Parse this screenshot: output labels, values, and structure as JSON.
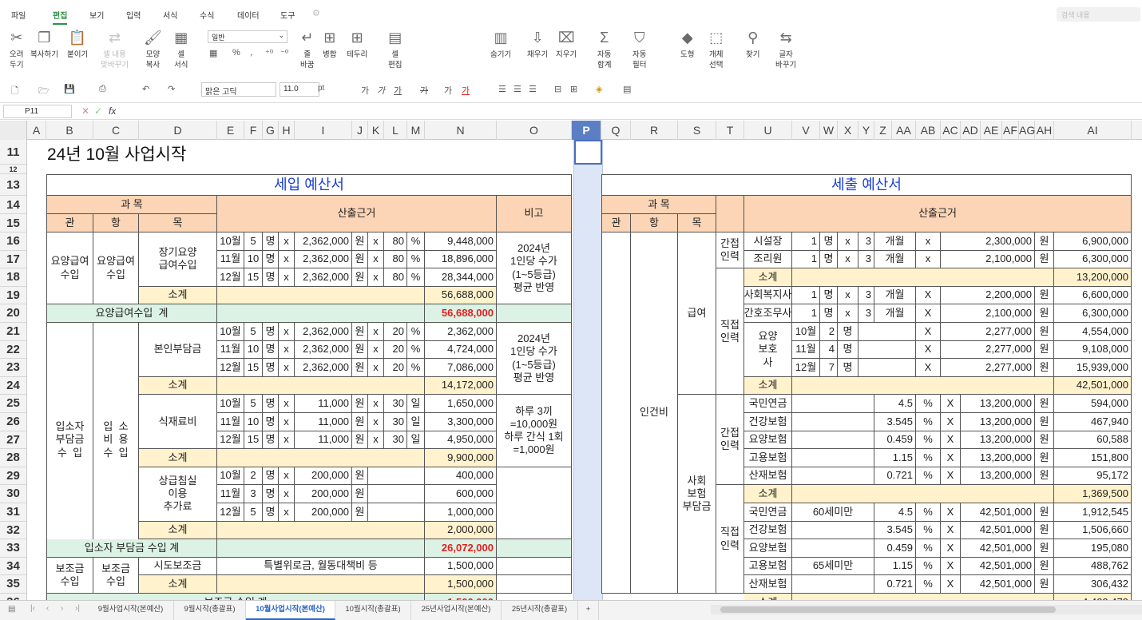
{
  "menus": [
    "파일",
    "편집",
    "보기",
    "입력",
    "서식",
    "수식",
    "데이터",
    "도구"
  ],
  "search_placeholder": "검색 내용",
  "ribbon": [
    {
      "id": "cut",
      "icon": "✂",
      "label": "오려\n두기",
      "dis": false
    },
    {
      "id": "copy",
      "icon": "❐",
      "label": "복사하기",
      "dis": false
    },
    {
      "id": "paste",
      "icon": "📋",
      "label": "붙이기",
      "dis": false
    },
    {
      "id": "paste-content",
      "icon": "⇄",
      "label": "셀 내용\n맞바꾸기",
      "dis": true
    },
    {
      "id": "format-copy",
      "icon": "🖌",
      "label": "모양\n복사",
      "dis": false
    },
    {
      "id": "cell-format",
      "icon": "▦",
      "label": "셀\n서식",
      "dis": false
    },
    {
      "id": "wrap",
      "icon": "↵",
      "label": "줄\n바꿈",
      "dis": false
    },
    {
      "id": "merge",
      "icon": "⊞",
      "label": "병합",
      "dis": false
    },
    {
      "id": "border",
      "icon": "⊞",
      "label": "테두리",
      "dis": false
    },
    {
      "id": "cell-edit",
      "icon": "▤",
      "label": "셀\n편집",
      "dis": false
    },
    {
      "id": "hide",
      "icon": "▥",
      "label": "숨기기",
      "dis": false
    },
    {
      "id": "fill",
      "icon": "⇩",
      "label": "채우기",
      "dis": false
    },
    {
      "id": "clear",
      "icon": "⌧",
      "label": "지우기",
      "dis": false
    },
    {
      "id": "autosum",
      "icon": "Σ",
      "label": "자동\n합계",
      "dis": false
    },
    {
      "id": "autofilter",
      "icon": "⛉",
      "label": "자동\n필터",
      "dis": false
    },
    {
      "id": "shape",
      "icon": "◆",
      "label": "도형",
      "dis": false
    },
    {
      "id": "select-obj",
      "icon": "⬚",
      "label": "개체\n선택",
      "dis": false
    },
    {
      "id": "find",
      "icon": "⚲",
      "label": "찾기",
      "dis": false
    },
    {
      "id": "replace",
      "icon": "⇆",
      "label": "글자\n바꾸기",
      "dis": false
    }
  ],
  "font_style": "일반",
  "percent": "%",
  "comma": ",",
  "toolbar": {
    "font": "맑은 고딕",
    "size": "11.0",
    "unit": "pt"
  },
  "formula": {
    "cell": "P11",
    "fx": "fx"
  },
  "columns": [
    "A",
    "B",
    "C",
    "D",
    "E",
    "F",
    "G",
    "H",
    "I",
    "J",
    "K",
    "L",
    "M",
    "N",
    "O",
    "P",
    "Q",
    "R",
    "S",
    "T",
    "U",
    "V",
    "W",
    "X",
    "Y",
    "Z",
    "AA",
    "AB",
    "AC",
    "AD",
    "AE",
    "AF",
    "AG",
    "AH",
    "AI"
  ],
  "rows": [
    "11",
    "12",
    "13",
    "14",
    "15",
    "16",
    "17",
    "18",
    "19",
    "20",
    "21",
    "22",
    "23",
    "24",
    "25",
    "26",
    "27",
    "28",
    "29",
    "30",
    "31",
    "32",
    "33",
    "34",
    "35",
    "36"
  ],
  "sheet_title": "24년 10월 사업시작",
  "income": {
    "heading": "세입 예산서",
    "subject": "과 목",
    "gwan": "관",
    "hang": "항",
    "mok": "목",
    "basis": "산출근거",
    "note": "비고"
  },
  "expense": {
    "heading": "세출 예산서",
    "subject": "과 목",
    "gwan": "관",
    "hang": "항",
    "mok": "목",
    "basis": "산출근거"
  },
  "cells": [
    [
      "B16:B19",
      "요양급여\n수입",
      ""
    ],
    [
      "C16:C19",
      "요양급여\n수입",
      ""
    ],
    [
      "D16:D18",
      "장기요양\n급여수입",
      ""
    ],
    [
      "E16",
      "10월",
      ""
    ],
    [
      "F16",
      "5",
      ""
    ],
    [
      "G16",
      "명",
      ""
    ],
    [
      "H16",
      "x",
      ""
    ],
    [
      "I16",
      "2,362,000",
      "R"
    ],
    [
      "J16",
      "원",
      ""
    ],
    [
      "K16",
      "x",
      ""
    ],
    [
      "L16",
      "80",
      "R"
    ],
    [
      "M16",
      "%",
      ""
    ],
    [
      "N16",
      "9,448,000",
      "R"
    ],
    [
      "E17",
      "11월",
      ""
    ],
    [
      "F17",
      "10",
      ""
    ],
    [
      "G17",
      "명",
      ""
    ],
    [
      "H17",
      "x",
      ""
    ],
    [
      "I17",
      "2,362,000",
      "R"
    ],
    [
      "J17",
      "원",
      ""
    ],
    [
      "K17",
      "x",
      ""
    ],
    [
      "L17",
      "80",
      "R"
    ],
    [
      "M17",
      "%",
      ""
    ],
    [
      "N17",
      "18,896,000",
      "R"
    ],
    [
      "E18",
      "12월",
      ""
    ],
    [
      "F18",
      "15",
      ""
    ],
    [
      "G18",
      "명",
      ""
    ],
    [
      "H18",
      "x",
      ""
    ],
    [
      "I18",
      "2,362,000",
      "R"
    ],
    [
      "J18",
      "원",
      ""
    ],
    [
      "K18",
      "x",
      ""
    ],
    [
      "L18",
      "80",
      "R"
    ],
    [
      "M18",
      "%",
      ""
    ],
    [
      "N18",
      "28,344,000",
      "R"
    ],
    [
      "O16:O19",
      "2024년\n1인당 수가\n(1~5등급)\n평균 반영",
      ""
    ],
    [
      "D19",
      "소계",
      "yl"
    ],
    [
      "E19:M19",
      "",
      "yl"
    ],
    [
      "N19",
      "56,688,000",
      "R yl"
    ],
    [
      "B20:D20",
      "요양급여수입  계",
      "gr"
    ],
    [
      "E20:M20",
      "",
      "gr"
    ],
    [
      "N20",
      "56,688,000",
      "R gr red"
    ],
    [
      "O20",
      "",
      "gr"
    ],
    [
      "B21:B33",
      "입소자\n부담금\n수  입",
      ""
    ],
    [
      "C21:C33",
      "입  소\n비  용\n수  입",
      ""
    ],
    [
      "D21:D23",
      "본인부담금",
      ""
    ],
    [
      "E21",
      "10월",
      ""
    ],
    [
      "F21",
      "5",
      ""
    ],
    [
      "G21",
      "명",
      ""
    ],
    [
      "H21",
      "x",
      ""
    ],
    [
      "I21",
      "2,362,000",
      "R"
    ],
    [
      "J21",
      "원",
      ""
    ],
    [
      "K21",
      "x",
      ""
    ],
    [
      "L21",
      "20",
      "R"
    ],
    [
      "M21",
      "%",
      ""
    ],
    [
      "N21",
      "2,362,000",
      "R"
    ],
    [
      "E22",
      "11월",
      ""
    ],
    [
      "F22",
      "10",
      ""
    ],
    [
      "G22",
      "명",
      ""
    ],
    [
      "H22",
      "x",
      ""
    ],
    [
      "I22",
      "2,362,000",
      "R"
    ],
    [
      "J22",
      "원",
      ""
    ],
    [
      "K22",
      "x",
      ""
    ],
    [
      "L22",
      "20",
      "R"
    ],
    [
      "M22",
      "%",
      ""
    ],
    [
      "N22",
      "4,724,000",
      "R"
    ],
    [
      "E23",
      "12월",
      ""
    ],
    [
      "F23",
      "15",
      ""
    ],
    [
      "G23",
      "명",
      ""
    ],
    [
      "H23",
      "x",
      ""
    ],
    [
      "I23",
      "2,362,000",
      "R"
    ],
    [
      "J23",
      "원",
      ""
    ],
    [
      "K23",
      "x",
      ""
    ],
    [
      "L23",
      "20",
      "R"
    ],
    [
      "M23",
      "%",
      ""
    ],
    [
      "N23",
      "7,086,000",
      "R"
    ],
    [
      "O21:O24",
      "2024년\n1인당 수가\n(1~5등급)\n평균 반영",
      ""
    ],
    [
      "D24",
      "소계",
      "yl"
    ],
    [
      "E24:M24",
      "",
      "yl"
    ],
    [
      "N24",
      "14,172,000",
      "R yl"
    ],
    [
      "D25:D27",
      "식재료비",
      ""
    ],
    [
      "E25",
      "10월",
      ""
    ],
    [
      "F25",
      "5",
      ""
    ],
    [
      "G25",
      "명",
      ""
    ],
    [
      "H25",
      "x",
      ""
    ],
    [
      "I25",
      "11,000",
      "R"
    ],
    [
      "J25",
      "원",
      ""
    ],
    [
      "K25",
      "x",
      ""
    ],
    [
      "L25",
      "30",
      "R"
    ],
    [
      "M25",
      "일",
      ""
    ],
    [
      "N25",
      "1,650,000",
      "R"
    ],
    [
      "E26",
      "11월",
      ""
    ],
    [
      "F26",
      "10",
      ""
    ],
    [
      "G26",
      "명",
      ""
    ],
    [
      "H26",
      "x",
      ""
    ],
    [
      "I26",
      "11,000",
      "R"
    ],
    [
      "J26",
      "원",
      ""
    ],
    [
      "K26",
      "x",
      ""
    ],
    [
      "L26",
      "30",
      "R"
    ],
    [
      "M26",
      "일",
      ""
    ],
    [
      "N26",
      "3,300,000",
      "R"
    ],
    [
      "E27",
      "12월",
      ""
    ],
    [
      "F27",
      "15",
      ""
    ],
    [
      "G27",
      "명",
      ""
    ],
    [
      "H27",
      "x",
      ""
    ],
    [
      "I27",
      "11,000",
      "R"
    ],
    [
      "J27",
      "원",
      ""
    ],
    [
      "K27",
      "x",
      ""
    ],
    [
      "L27",
      "30",
      "R"
    ],
    [
      "M27",
      "일",
      ""
    ],
    [
      "N27",
      "4,950,000",
      "R"
    ],
    [
      "O25:O28",
      "하루 3끼\n=10,000원\n하루 간식 1회\n=1,000원",
      ""
    ],
    [
      "D28",
      "소계",
      "yl"
    ],
    [
      "E28:M28",
      "",
      "yl"
    ],
    [
      "N28",
      "9,900,000",
      "R yl"
    ],
    [
      "D29:D31",
      "상급침실\n이용\n추가료",
      ""
    ],
    [
      "E29",
      "10월",
      ""
    ],
    [
      "F29",
      "2",
      ""
    ],
    [
      "G29",
      "명",
      ""
    ],
    [
      "H29",
      "x",
      ""
    ],
    [
      "I29",
      "200,000",
      "R"
    ],
    [
      "J29",
      "원",
      ""
    ],
    [
      "K29:M29",
      "",
      ""
    ],
    [
      "N29",
      "400,000",
      "R"
    ],
    [
      "E30",
      "11월",
      ""
    ],
    [
      "F30",
      "3",
      ""
    ],
    [
      "G30",
      "명",
      ""
    ],
    [
      "H30",
      "x",
      ""
    ],
    [
      "I30",
      "200,000",
      "R"
    ],
    [
      "J30",
      "원",
      ""
    ],
    [
      "K30:M30",
      "",
      ""
    ],
    [
      "N30",
      "600,000",
      "R"
    ],
    [
      "E31",
      "12월",
      ""
    ],
    [
      "F31",
      "5",
      ""
    ],
    [
      "G31",
      "명",
      ""
    ],
    [
      "H31",
      "x",
      ""
    ],
    [
      "I31",
      "200,000",
      "R"
    ],
    [
      "J31",
      "원",
      ""
    ],
    [
      "K31:M31",
      "",
      ""
    ],
    [
      "N31",
      "1,000,000",
      "R"
    ],
    [
      "O29:O32",
      "",
      ""
    ],
    [
      "D32",
      "소계",
      "yl"
    ],
    [
      "E32:M32",
      "",
      "yl"
    ],
    [
      "N32",
      "2,000,000",
      "R yl"
    ],
    [
      "B33:D33",
      "입소자 부담금 수입 계",
      "gr"
    ],
    [
      "E33:M33",
      "",
      "gr"
    ],
    [
      "N33",
      "26,072,000",
      "R gr red"
    ],
    [
      "O33",
      "",
      "gr"
    ],
    [
      "B34:B35",
      "보조금\n수입",
      ""
    ],
    [
      "C34:C35",
      "보조금\n수입",
      ""
    ],
    [
      "D34",
      "시도보조금",
      ""
    ],
    [
      "E34:M34",
      "특별위로금, 월동대책비 등",
      ""
    ],
    [
      "N34",
      "1,500,000",
      "R"
    ],
    [
      "O34",
      "",
      ""
    ],
    [
      "D35",
      "소계",
      "yl"
    ],
    [
      "E35:M35",
      "",
      "yl"
    ],
    [
      "N35",
      "1,500,000",
      "R yl"
    ],
    [
      "O35",
      "",
      ""
    ],
    [
      "Q16:Q35",
      "",
      ""
    ],
    [
      "R16:R35",
      "인건비",
      ""
    ],
    [
      "S16:S24",
      "급여",
      ""
    ],
    [
      "S25:S35",
      "사회\n보험\n부담금",
      ""
    ],
    [
      "T16:T17",
      "간접\n인력",
      ""
    ],
    [
      "U16",
      "시설장",
      ""
    ],
    [
      "V16",
      "1",
      "R"
    ],
    [
      "W16",
      "명",
      ""
    ],
    [
      "X16",
      "x",
      ""
    ],
    [
      "Y16",
      "3",
      "R"
    ],
    [
      "Z16:AA16",
      "개월",
      ""
    ],
    [
      "AB16",
      "x",
      ""
    ],
    [
      "AC16:AG16",
      "2,300,000",
      "R"
    ],
    [
      "AH16",
      "원",
      ""
    ],
    [
      "AI16",
      "6,900,000",
      "R"
    ],
    [
      "U17",
      "조리원",
      ""
    ],
    [
      "V17",
      "1",
      "R"
    ],
    [
      "W17",
      "명",
      ""
    ],
    [
      "X17",
      "x",
      ""
    ],
    [
      "Y17",
      "3",
      "R"
    ],
    [
      "Z17:AA17",
      "개월",
      ""
    ],
    [
      "AB17",
      "x",
      ""
    ],
    [
      "AC17:AG17",
      "2,100,000",
      "R"
    ],
    [
      "AH17",
      "원",
      ""
    ],
    [
      "AI17",
      "6,300,000",
      "R"
    ],
    [
      "T18:T24",
      "직접\n인력",
      ""
    ],
    [
      "U18",
      "소계",
      "yl"
    ],
    [
      "V18:AH18",
      "",
      "yl"
    ],
    [
      "AI18",
      "13,200,000",
      "R yl"
    ],
    [
      "U19",
      "사회복지사",
      ""
    ],
    [
      "V19",
      "1",
      "R"
    ],
    [
      "W19",
      "명",
      ""
    ],
    [
      "X19",
      "x",
      ""
    ],
    [
      "Y19",
      "3",
      "R"
    ],
    [
      "Z19:AA19",
      "개월",
      ""
    ],
    [
      "AB19",
      "X",
      ""
    ],
    [
      "AC19:AG19",
      "2,200,000",
      "R"
    ],
    [
      "AH19",
      "원",
      ""
    ],
    [
      "AI19",
      "6,600,000",
      "R"
    ],
    [
      "U20",
      "간호조무사",
      ""
    ],
    [
      "V20",
      "1",
      "R"
    ],
    [
      "W20",
      "명",
      ""
    ],
    [
      "X20",
      "x",
      ""
    ],
    [
      "Y20",
      "3",
      "R"
    ],
    [
      "Z20:AA20",
      "개월",
      ""
    ],
    [
      "AB20",
      "X",
      ""
    ],
    [
      "AC20:AG20",
      "2,100,000",
      "R"
    ],
    [
      "AH20",
      "원",
      ""
    ],
    [
      "AI20",
      "6,300,000",
      "R"
    ],
    [
      "U21:U23",
      "요양\n보호\n사",
      ""
    ],
    [
      "V21",
      "10월",
      ""
    ],
    [
      "W21",
      "2",
      "R"
    ],
    [
      "X21",
      "명",
      ""
    ],
    [
      "Y21:AA21",
      "",
      ""
    ],
    [
      "AB21",
      "X",
      ""
    ],
    [
      "AC21:AG21",
      "2,277,000",
      "R"
    ],
    [
      "AH21",
      "원",
      ""
    ],
    [
      "AI21",
      "4,554,000",
      "R"
    ],
    [
      "V22",
      "11월",
      ""
    ],
    [
      "W22",
      "4",
      "R"
    ],
    [
      "X22",
      "명",
      ""
    ],
    [
      "Y22:AA22",
      "",
      ""
    ],
    [
      "AB22",
      "X",
      ""
    ],
    [
      "AC22:AG22",
      "2,277,000",
      "R"
    ],
    [
      "AH22",
      "원",
      ""
    ],
    [
      "AI22",
      "9,108,000",
      "R"
    ],
    [
      "V23",
      "12월",
      ""
    ],
    [
      "W23",
      "7",
      "R"
    ],
    [
      "X23",
      "명",
      ""
    ],
    [
      "Y23:AA23",
      "",
      ""
    ],
    [
      "AB23",
      "X",
      ""
    ],
    [
      "AC23:AG23",
      "2,277,000",
      "R"
    ],
    [
      "AH23",
      "원",
      ""
    ],
    [
      "AI23",
      "15,939,000",
      "R"
    ],
    [
      "U24",
      "소계",
      "yl"
    ],
    [
      "V24:AH24",
      "",
      "yl"
    ],
    [
      "AI24",
      "42,501,000",
      "R yl"
    ],
    [
      "T25:T29",
      "간접\n인력",
      ""
    ],
    [
      "U25",
      "국민연금",
      ""
    ],
    [
      "V25:Y25",
      "",
      ""
    ],
    [
      "Z25:AA25",
      "4.5",
      "R"
    ],
    [
      "AB25",
      "%",
      ""
    ],
    [
      "AC25",
      "X",
      ""
    ],
    [
      "AD25:AG25",
      "13,200,000",
      "R"
    ],
    [
      "AH25",
      "원",
      ""
    ],
    [
      "AI25",
      "594,000",
      "R"
    ],
    [
      "U26",
      "건강보험",
      ""
    ],
    [
      "V26:Y26",
      "",
      ""
    ],
    [
      "Z26:AA26",
      "3.545",
      "R"
    ],
    [
      "AB26",
      "%",
      ""
    ],
    [
      "AC26",
      "X",
      ""
    ],
    [
      "AD26:AG26",
      "13,200,000",
      "R"
    ],
    [
      "AH26",
      "원",
      ""
    ],
    [
      "AI26",
      "467,940",
      "R"
    ],
    [
      "U27",
      "요양보험",
      ""
    ],
    [
      "V27:Y27",
      "",
      ""
    ],
    [
      "Z27:AA27",
      "0.459",
      "R"
    ],
    [
      "AB27",
      "%",
      ""
    ],
    [
      "AC27",
      "X",
      ""
    ],
    [
      "AD27:AG27",
      "13,200,000",
      "R"
    ],
    [
      "AH27",
      "원",
      ""
    ],
    [
      "AI27",
      "60,588",
      "R"
    ],
    [
      "U28",
      "고용보험",
      ""
    ],
    [
      "V28:Y28",
      "",
      ""
    ],
    [
      "Z28:AA28",
      "1.15",
      "R"
    ],
    [
      "AB28",
      "%",
      ""
    ],
    [
      "AC28",
      "X",
      ""
    ],
    [
      "AD28:AG28",
      "13,200,000",
      "R"
    ],
    [
      "AH28",
      "원",
      ""
    ],
    [
      "AI28",
      "151,800",
      "R"
    ],
    [
      "U29",
      "산재보험",
      ""
    ],
    [
      "V29:Y29",
      "",
      ""
    ],
    [
      "Z29:AA29",
      "0.721",
      "R"
    ],
    [
      "AB29",
      "%",
      ""
    ],
    [
      "AC29",
      "X",
      ""
    ],
    [
      "AD29:AG29",
      "13,200,000",
      "R"
    ],
    [
      "AH29",
      "원",
      ""
    ],
    [
      "AI29",
      "95,172",
      "R"
    ],
    [
      "T30:T35",
      "직접\n인력",
      ""
    ],
    [
      "U30",
      "소계",
      "yl"
    ],
    [
      "V30:AH30",
      "",
      "yl"
    ],
    [
      "AI30",
      "1,369,500",
      "R yl"
    ],
    [
      "U31",
      "국민연금",
      ""
    ],
    [
      "V31:Y31",
      "60세미만",
      ""
    ],
    [
      "Z31:AA31",
      "4.5",
      "R"
    ],
    [
      "AB31",
      "%",
      ""
    ],
    [
      "AC31",
      "X",
      ""
    ],
    [
      "AD31:AG31",
      "42,501,000",
      "R"
    ],
    [
      "AH31",
      "원",
      ""
    ],
    [
      "AI31",
      "1,912,545",
      "R"
    ],
    [
      "U32",
      "건강보험",
      ""
    ],
    [
      "V32:Y32",
      "",
      ""
    ],
    [
      "Z32:AA32",
      "3.545",
      "R"
    ],
    [
      "AB32",
      "%",
      ""
    ],
    [
      "AC32",
      "X",
      ""
    ],
    [
      "AD32:AG32",
      "42,501,000",
      "R"
    ],
    [
      "AH32",
      "원",
      ""
    ],
    [
      "AI32",
      "1,506,660",
      "R"
    ],
    [
      "U33",
      "요양보험",
      ""
    ],
    [
      "V33:Y33",
      "",
      ""
    ],
    [
      "Z33:AA33",
      "0.459",
      "R"
    ],
    [
      "AB33",
      "%",
      ""
    ],
    [
      "AC33",
      "X",
      ""
    ],
    [
      "AD33:AG33",
      "42,501,000",
      "R"
    ],
    [
      "AH33",
      "원",
      ""
    ],
    [
      "AI33",
      "195,080",
      "R"
    ],
    [
      "U34",
      "고용보험",
      ""
    ],
    [
      "V34:Y34",
      "65세미만",
      ""
    ],
    [
      "Z34:AA34",
      "1.15",
      "R"
    ],
    [
      "AB34",
      "%",
      ""
    ],
    [
      "AC34",
      "X",
      ""
    ],
    [
      "AD34:AG34",
      "42,501,000",
      "R"
    ],
    [
      "AH34",
      "원",
      ""
    ],
    [
      "AI34",
      "488,762",
      "R"
    ],
    [
      "U35",
      "산재보험",
      ""
    ],
    [
      "V35:Y35",
      "",
      ""
    ],
    [
      "Z35:AA35",
      "0.721",
      "R"
    ],
    [
      "AB35",
      "%",
      ""
    ],
    [
      "AC35",
      "X",
      ""
    ],
    [
      "AD35:AG35",
      "42,501,000",
      "R"
    ],
    [
      "AH35",
      "원",
      ""
    ],
    [
      "AI35",
      "306,432",
      "R"
    ],
    [
      "B36:M36",
      "보조금 수입 계",
      "gr"
    ],
    [
      "N36",
      "1,500,000",
      "R gr red"
    ],
    [
      "U36",
      "소계",
      "yl"
    ],
    [
      "V36:AH36",
      "",
      "yl"
    ],
    [
      "AI36",
      "4,409,479",
      "R yl"
    ]
  ],
  "tabs": [
    "9월사업시작(본예산)",
    "9월시작(총괄표)",
    "10월사업시작(본예산)",
    "10월시작(총괄표)",
    "25년사업시작(본예산)",
    "25년시작(총괄표)",
    "+"
  ]
}
